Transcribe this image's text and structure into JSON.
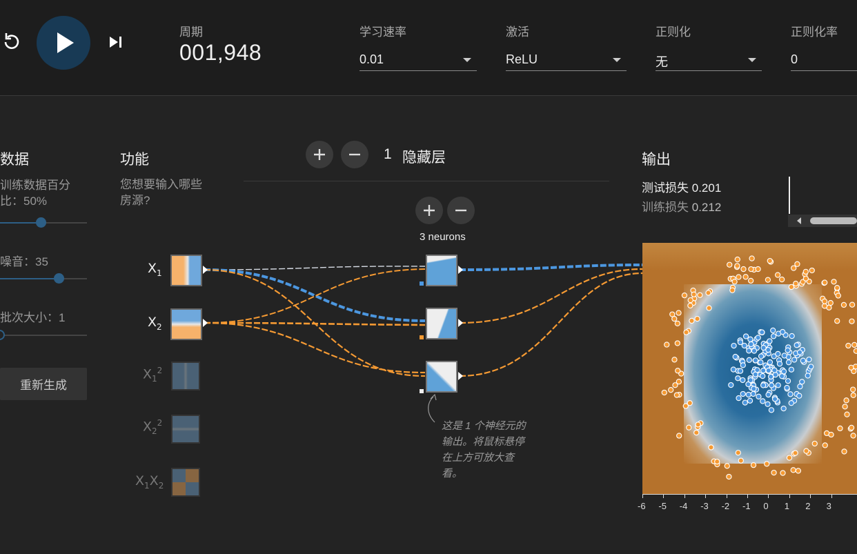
{
  "controls": {
    "epoch_label": "周期",
    "epoch_value": "001,948",
    "learning_rate_label": "学习速率",
    "learning_rate_value": "0.01",
    "activation_label": "激活",
    "activation_value": "ReLU",
    "regularization_label": "正则化",
    "regularization_value": "无",
    "reg_rate_label": "正则化率",
    "reg_rate_value": "0"
  },
  "data_panel": {
    "title": "数据",
    "ratio_text": "训练数据百分比：50%",
    "ratio_line1": "训练数据百分",
    "ratio_line2": "比：50%",
    "ratio_value": 0.5,
    "noise_text": "噪音：35",
    "noise_value": 35,
    "batch_text": "批次大小：1",
    "batch_value": 1,
    "regenerate_label": "重新生成"
  },
  "features": {
    "title": "功能",
    "desc_line1": "您想要输入哪些",
    "desc_line2": "房源?",
    "items": [
      {
        "base": "X",
        "sub": "1",
        "sup": "",
        "active": true
      },
      {
        "base": "X",
        "sub": "2",
        "sup": "",
        "active": true
      },
      {
        "base": "X",
        "sub": "1",
        "sup": "2",
        "active": false
      },
      {
        "base": "X",
        "sub": "2",
        "sup": "2",
        "active": false
      },
      {
        "base": "X",
        "sub": "1",
        "base2": "X",
        "sub2": "2",
        "active": false
      }
    ]
  },
  "network": {
    "hidden_layers_count": "1",
    "hidden_layers_label": "隐藏层",
    "neurons_label": "3 neurons",
    "annotation_line1": "这是 1 个神经元的",
    "annotation_line2": "输出。将鼠标悬停",
    "annotation_line3": "在上方可放大查",
    "annotation_line4": "看。",
    "annotation_bold": "神经元"
  },
  "output": {
    "title": "输出",
    "test_loss_label": "测试损失",
    "test_loss_value": "0.201",
    "train_loss_label": "训练损失",
    "train_loss_value": "0.212",
    "axis_ticks": [
      "-6",
      "-5",
      "-4",
      "-3",
      "-2",
      "-1",
      "0",
      "1",
      "2",
      "3"
    ]
  },
  "colors": {
    "positive": "#4c97e0",
    "negative": "#f59a33",
    "accent": "#183a55",
    "heat_orange": "#b5722c",
    "heat_blue": "#2a6d9e"
  }
}
